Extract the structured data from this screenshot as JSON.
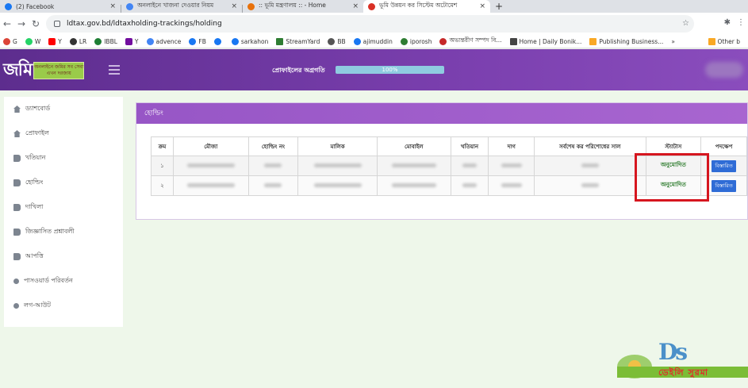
{
  "browser": {
    "tabs": [
      {
        "label": "(2) Facebook",
        "favicon_color": "#1877f2",
        "active": false
      },
      {
        "label": "অনলাইনে খাজনা দেওয়ার নিয়ম",
        "favicon_color": "#4285f4",
        "active": false
      },
      {
        "label": ":: ভূমি মন্ত্রণালয় :: - Home",
        "favicon_color": "#e8710a",
        "active": false
      },
      {
        "label": "ভূমি উন্নয়ন কর সিস্টেম অটোমেশ",
        "favicon_color": "#d93025",
        "active": true
      }
    ],
    "new_tab": "+",
    "close_glyph": "×",
    "url": "ldtax.gov.bd/ldtaxholding-trackings/holding",
    "nav": {
      "back": "←",
      "forward": "→",
      "reload": "↻"
    },
    "bookmarks": [
      {
        "label": "G",
        "color": "#db4437"
      },
      {
        "label": "W",
        "color": "#25d366"
      },
      {
        "label": "Y",
        "color": "#ff0000"
      },
      {
        "label": "LR",
        "color": "#333333"
      },
      {
        "label": "IBBL",
        "color": "#1e7e34"
      },
      {
        "label": "Y",
        "color": "#720e9e"
      },
      {
        "label": "advence",
        "color": "#4285f4"
      },
      {
        "label": "FB",
        "color": "#1877f2"
      },
      {
        "label": "",
        "color": "#1877f2"
      },
      {
        "label": "sarkahon",
        "color": "#1877f2"
      },
      {
        "label": "StreamYard",
        "color": "#2e7d32"
      },
      {
        "label": "BB",
        "color": "#555555"
      },
      {
        "label": "ajimuddin",
        "color": "#1877f2"
      },
      {
        "label": "iporosh",
        "color": "#2e7d32"
      },
      {
        "label": "অভ্যন্তরীণ সম্পদ বি...",
        "color": "#c62828"
      },
      {
        "label": "Home | Daily Bonik...",
        "color": "#444444"
      },
      {
        "label": "Publishing Business...",
        "color": "#f9a825"
      }
    ],
    "bookmarks_more": "»",
    "other_bookmarks": "Other b"
  },
  "header": {
    "logo_text": "জমি",
    "logo_tag_line1": "অনলাইনে জমির সব সেবা",
    "logo_tag_line2": "এখন দরজায়",
    "progress_label": "প্রোফাইলের অগ্রগতি",
    "progress_text": "100%",
    "progress_fraction": 1.0
  },
  "sidebar": {
    "items": [
      {
        "label": "ড্যাশবোর্ড",
        "icon": "home-icon"
      },
      {
        "label": "প্রোফাইল",
        "icon": "home-icon"
      },
      {
        "label": "খতিয়ান",
        "icon": "book-icon"
      },
      {
        "label": "হোল্ডিং",
        "icon": "book-icon"
      },
      {
        "label": "দাখিলা",
        "icon": "book-icon"
      },
      {
        "label": "জিজ্ঞাসিত প্রশ্নাবলী",
        "icon": "book-icon"
      },
      {
        "label": "আপত্তি",
        "icon": "book-icon"
      },
      {
        "label": "পাসওয়ার্ড পরিবর্তন",
        "icon": "key-icon"
      },
      {
        "label": "লগ-আউট",
        "icon": "key-icon"
      }
    ]
  },
  "panel": {
    "title": "হোল্ডিং",
    "columns": [
      "ক্রম",
      "মৌজা",
      "হোল্ডিং নং",
      "মালিক",
      "মোবাইল",
      "খতিয়ান",
      "দাগ",
      "সর্বশেষ কর পরিশোধের সাল",
      "স্ট্যাটাস",
      "পদক্ষেপ"
    ],
    "rows": [
      {
        "serial": "১",
        "status": "অনুমোদিত",
        "action": "বিস্তারিত"
      },
      {
        "serial": "২",
        "status": "অনুমোদিত",
        "action": "বিস্তারিত"
      }
    ]
  },
  "watermark": {
    "mark": "Ds",
    "name": "ডেইলি সুরমা"
  },
  "colors": {
    "header_purple": "#6a34a0",
    "panel_head": "#9d5cc9",
    "status_green": "#2a7a2a",
    "highlight_red": "#d6161f",
    "action_blue": "#2f6cd6"
  }
}
